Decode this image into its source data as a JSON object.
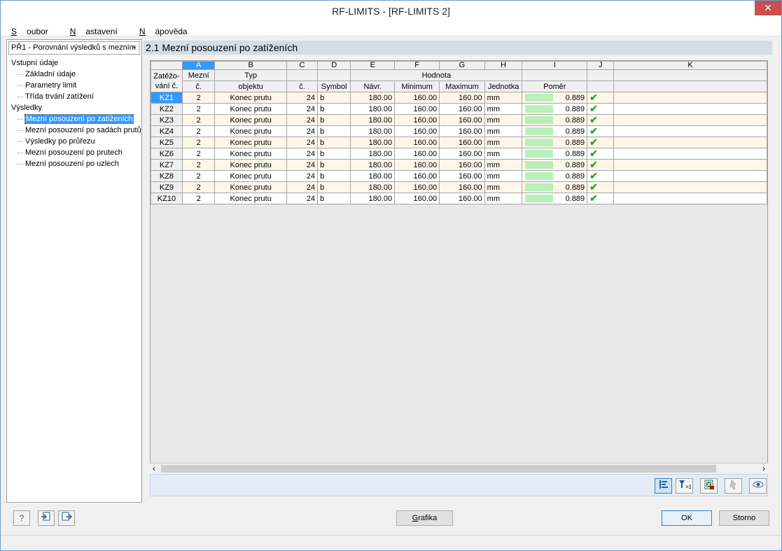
{
  "window": {
    "title": "RF-LIMITS - [RF-LIMITS 2]",
    "close_glyph": "✕"
  },
  "menu": [
    {
      "label": "Soubor",
      "accel": "S",
      "rest": "oubor"
    },
    {
      "label": "Nastavení",
      "accel": "N",
      "rest": "astavení"
    },
    {
      "label": "Nápověda",
      "accel": "N",
      "rest": "ápověda"
    }
  ],
  "left": {
    "combo_value": "PŘ1 - Porovnání výsledků s mezním",
    "tree": {
      "group1": "Vstupní údaje",
      "g1_items": [
        "Základní údaje",
        "Parametry limit",
        "Třída trvání zatížení"
      ],
      "group2": "Výsledky",
      "g2_items": [
        "Mezní posouzení po zatíženích",
        "Mezní posouzení po sadách prutů",
        "Výsledky po průřezu",
        "Mezní posouzení po prutech",
        "Mezní posouzení po uzlech"
      ]
    }
  },
  "main": {
    "heading": "2.1 Mezní posouzení po zatíženích",
    "columns": [
      "A",
      "B",
      "C",
      "D",
      "E",
      "F",
      "G",
      "H",
      "I",
      "J",
      "K"
    ],
    "header": {
      "rowhdr1": "Zatěžo-",
      "rowhdr2": "vání č.",
      "a1": "Mezní",
      "a2": "č.",
      "b1": "Typ",
      "b2": "objektu",
      "c2": "č.",
      "d2": "Symbol",
      "hodnota": "Hodnota",
      "e2": "Návr.",
      "f2": "Minimum",
      "g2": "Maximum",
      "h2": "Jednotka",
      "i2": "Poměr"
    },
    "rows": [
      {
        "lc": "KZ1",
        "limit": "2",
        "type": "Konec prutu",
        "no": "24",
        "symbol": "b",
        "design": "180.00",
        "min": "160.00",
        "max": "160.00",
        "unit": "mm",
        "ratio": "0.889",
        "ratio_value": 0.889
      },
      {
        "lc": "KZ2",
        "limit": "2",
        "type": "Konec prutu",
        "no": "24",
        "symbol": "b",
        "design": "180.00",
        "min": "160.00",
        "max": "160.00",
        "unit": "mm",
        "ratio": "0.889",
        "ratio_value": 0.889
      },
      {
        "lc": "KZ3",
        "limit": "2",
        "type": "Konec prutu",
        "no": "24",
        "symbol": "b",
        "design": "180.00",
        "min": "160.00",
        "max": "160.00",
        "unit": "mm",
        "ratio": "0.889",
        "ratio_value": 0.889
      },
      {
        "lc": "KZ4",
        "limit": "2",
        "type": "Konec prutu",
        "no": "24",
        "symbol": "b",
        "design": "180.00",
        "min": "160.00",
        "max": "160.00",
        "unit": "mm",
        "ratio": "0.889",
        "ratio_value": 0.889
      },
      {
        "lc": "KZ5",
        "limit": "2",
        "type": "Konec prutu",
        "no": "24",
        "symbol": "b",
        "design": "180.00",
        "min": "160.00",
        "max": "160.00",
        "unit": "mm",
        "ratio": "0.889",
        "ratio_value": 0.889
      },
      {
        "lc": "KZ6",
        "limit": "2",
        "type": "Konec prutu",
        "no": "24",
        "symbol": "b",
        "design": "180.00",
        "min": "160.00",
        "max": "160.00",
        "unit": "mm",
        "ratio": "0.889",
        "ratio_value": 0.889
      },
      {
        "lc": "KZ7",
        "limit": "2",
        "type": "Konec prutu",
        "no": "24",
        "symbol": "b",
        "design": "180.00",
        "min": "160.00",
        "max": "160.00",
        "unit": "mm",
        "ratio": "0.889",
        "ratio_value": 0.889
      },
      {
        "lc": "KZ8",
        "limit": "2",
        "type": "Konec prutu",
        "no": "24",
        "symbol": "b",
        "design": "180.00",
        "min": "160.00",
        "max": "160.00",
        "unit": "mm",
        "ratio": "0.889",
        "ratio_value": 0.889
      },
      {
        "lc": "KZ9",
        "limit": "2",
        "type": "Konec prutu",
        "no": "24",
        "symbol": "b",
        "design": "180.00",
        "min": "160.00",
        "max": "160.00",
        "unit": "mm",
        "ratio": "0.889",
        "ratio_value": 0.889
      },
      {
        "lc": "KZ10",
        "limit": "2",
        "type": "Konec prutu",
        "no": "24",
        "symbol": "b",
        "design": "180.00",
        "min": "160.00",
        "max": "160.00",
        "unit": "mm",
        "ratio": "0.889",
        "ratio_value": 0.889
      }
    ],
    "check_glyph": "✔",
    "toolbar_icons": [
      "filter-columns-icon",
      "filter-ratio-icon",
      "export-excel-icon",
      "pick-icon",
      "view-icon"
    ]
  },
  "bottom": {
    "grafika": "Grafika",
    "grafika_accel": "G",
    "grafika_rest": "rafika",
    "ok": "OK",
    "storno": "Storno",
    "help_glyph": "?"
  },
  "colors": {
    "accent": "#3399ff",
    "ratio_bar": "#b9f0b9",
    "check": "#2aa52a",
    "odd_row": "#fdf7ea"
  }
}
